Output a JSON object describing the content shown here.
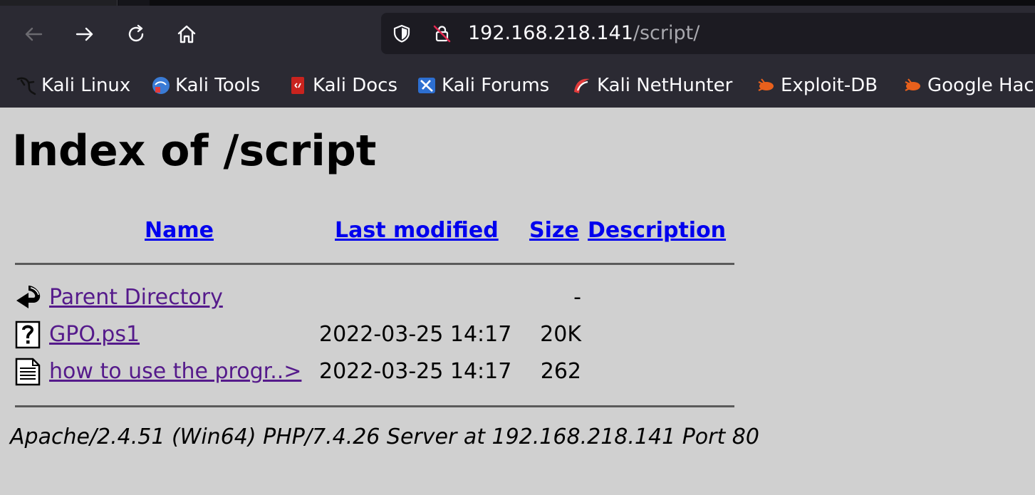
{
  "browser": {
    "url_host": "192.168.218.141",
    "url_path": "/script/",
    "bookmarks": [
      {
        "label": "Kali Linux",
        "icon": "kali-dragon-icon"
      },
      {
        "label": "Kali Tools",
        "icon": "kali-tools-icon"
      },
      {
        "label": "Kali Docs",
        "icon": "kali-docs-icon"
      },
      {
        "label": "Kali Forums",
        "icon": "kali-forums-icon"
      },
      {
        "label": "Kali NetHunter",
        "icon": "kali-nethunter-icon"
      },
      {
        "label": "Exploit-DB",
        "icon": "exploit-db-icon"
      },
      {
        "label": "Google Hac",
        "icon": "exploit-db-icon"
      }
    ]
  },
  "page": {
    "title": "Index of /script",
    "columns": {
      "name": "Name",
      "last_modified": "Last modified",
      "size": "Size",
      "description": "Description"
    },
    "rows": [
      {
        "icon": "back-arrow-icon",
        "name": "Parent Directory",
        "date": "",
        "size": "-"
      },
      {
        "icon": "unknown-file-icon",
        "name": "GPO.ps1",
        "date": "2022-03-25 14:17",
        "size": "20K"
      },
      {
        "icon": "text-file-icon",
        "name": "how to use the progr..>",
        "date": "2022-03-25 14:17",
        "size": "262"
      }
    ],
    "footer": "Apache/2.4.51 (Win64) PHP/7.4.26 Server at 192.168.218.141 Port 80"
  }
}
